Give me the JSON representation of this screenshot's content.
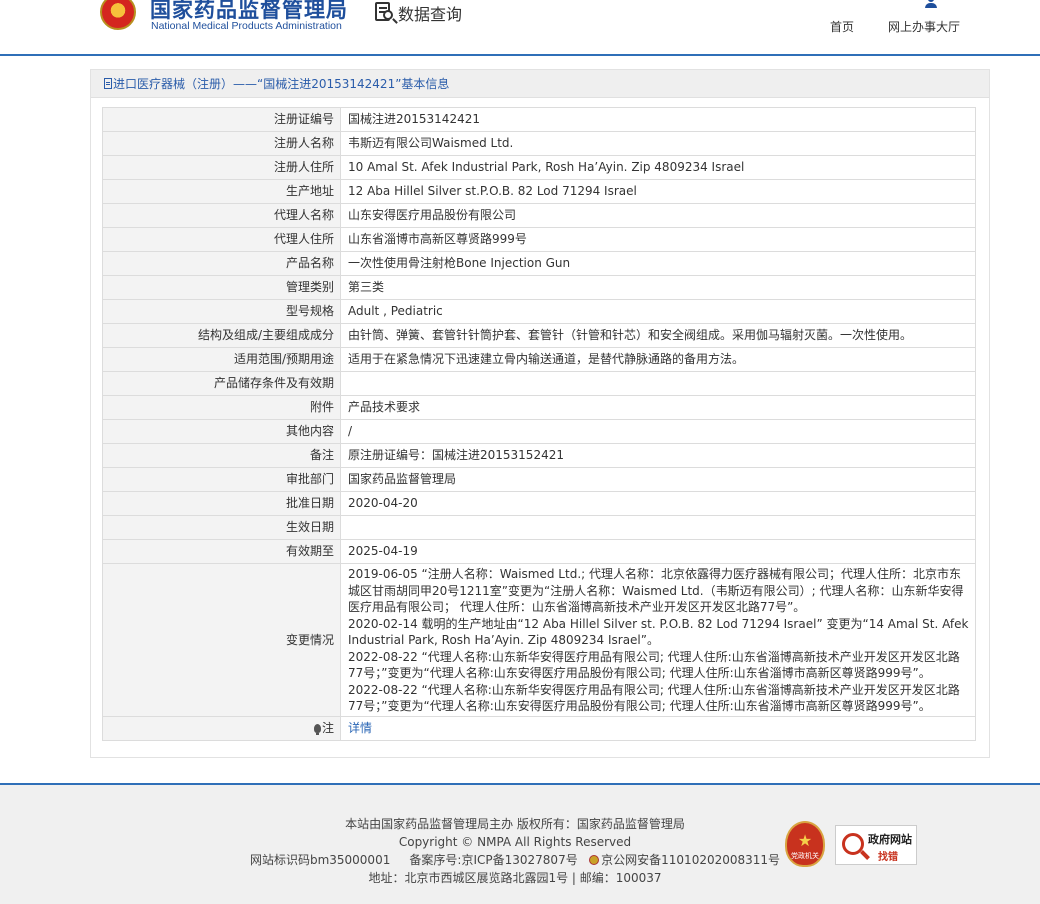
{
  "header": {
    "logo_cn": "国家药品监督管理局",
    "logo_en": "National Medical Products Administration",
    "query_label": "数据查询",
    "nav": [
      {
        "label": "首页",
        "icon": "home-icon"
      },
      {
        "label": "网上办事大厅",
        "icon": "user-icon"
      }
    ]
  },
  "panel": {
    "title": "进口医疗器械（注册）——“国械注进20153142421”基本信息"
  },
  "rows": [
    {
      "label": "注册证编号",
      "value": "国械注进20153142421"
    },
    {
      "label": "注册人名称",
      "value": "韦斯迈有限公司Waismed Ltd."
    },
    {
      "label": "注册人住所",
      "value": "10 Amal St. Afek Industrial Park, Rosh Ha’Ayin. Zip 4809234 Israel"
    },
    {
      "label": "生产地址",
      "value": "12 Aba Hillel Silver st.P.O.B. 82 Lod 71294 Israel"
    },
    {
      "label": "代理人名称",
      "value": "山东安得医疗用品股份有限公司"
    },
    {
      "label": "代理人住所",
      "value": "山东省淄博市高新区尊贤路999号"
    },
    {
      "label": "产品名称",
      "value": "一次性使用骨注射枪Bone Injection Gun"
    },
    {
      "label": "管理类别",
      "value": "第三类"
    },
    {
      "label": "型号规格",
      "value": "Adult , Pediatric"
    },
    {
      "label": "结构及组成/主要组成成分",
      "value": "由针筒、弹簧、套管针针筒护套、套管针（针管和针芯）和安全阀组成。采用伽马辐射灭菌。一次性使用。"
    },
    {
      "label": "适用范围/预期用途",
      "value": "适用于在紧急情况下迅速建立骨内输送通道，是替代静脉通路的备用方法。"
    },
    {
      "label": "产品储存条件及有效期",
      "value": ""
    },
    {
      "label": "附件",
      "value": "产品技术要求"
    },
    {
      "label": "其他内容",
      "value": "/"
    },
    {
      "label": "备注",
      "value": "原注册证编号：国械注进20153152421"
    },
    {
      "label": "审批部门",
      "value": "国家药品监督管理局"
    },
    {
      "label": "批准日期",
      "value": "2020-04-20"
    },
    {
      "label": "生效日期",
      "value": ""
    },
    {
      "label": "有效期至",
      "value": "2025-04-19"
    }
  ],
  "changes": {
    "label": "变更情况",
    "lines": [
      "2019-06-05 “注册人名称：Waismed Ltd.; 代理人名称：北京依露得力医疗器械有限公司；代理人住所：北京市东城区甘雨胡同甲20号1211室”变更为“注册人名称：Waismed Ltd.（韦斯迈有限公司）; 代理人名称：山东新华安得医疗用品有限公司； 代理人住所：山东省淄博高新技术产业开发区开发区北路77号”。",
      "2020-02-14 载明的生产地址由“12 Aba Hillel Silver st. P.O.B. 82 Lod 71294 Israel” 变更为“14 Amal St. Afek Industrial Park, Rosh Ha’Ayin. Zip 4809234 Israel”。",
      "2022-08-22 “代理人名称:山东新华安得医疗用品有限公司; 代理人住所:山东省淄博高新技术产业开发区开发区北路77号；”变更为“代理人名称:山东安得医疗用品股份有限公司; 代理人住所:山东省淄博市高新区尊贤路999号”。",
      "2022-08-22 “代理人名称:山东新华安得医疗用品有限公司; 代理人住所:山东省淄博高新技术产业开发区开发区北路77号；”变更为“代理人名称:山东安得医疗用品股份有限公司; 代理人住所:山东省淄博市高新区尊贤路999号”。"
    ]
  },
  "note_row": {
    "label": "注",
    "link": "详情"
  },
  "footer": {
    "line1": "本站由国家药品监督管理局主办 版权所有：国家药品监督管理局",
    "line2": "Copyright © NMPA All Rights Reserved",
    "site_id": "网站标识码bm35000001",
    "icp": "备案序号:京ICP备13027807号",
    "police": "京公网安备11010202008311号",
    "address": "地址：北京市西城区展览路北露园1号 | 邮编：100037",
    "party_badge": "党政机关",
    "gov_badge_1": "政府网站",
    "gov_badge_2": "找错"
  }
}
